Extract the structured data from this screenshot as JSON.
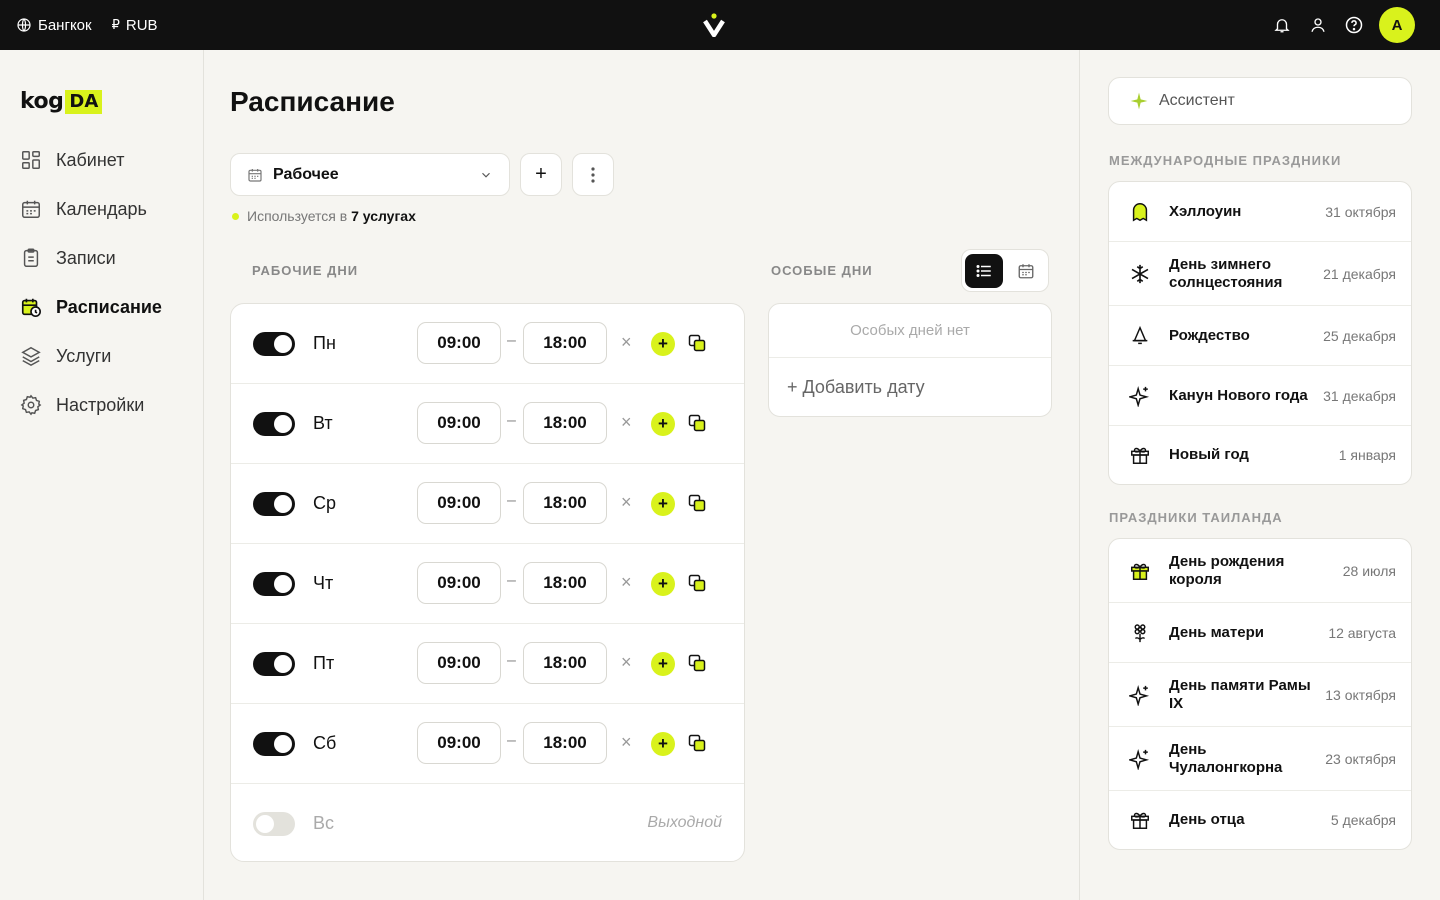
{
  "topbar": {
    "city": "Бангкок",
    "currency": "RUB",
    "avatar_letter": "A"
  },
  "logo": {
    "part1": "kog",
    "part2": "DA"
  },
  "sidebar": {
    "items": [
      {
        "label": "Кабинет",
        "icon": "dashboard-icon"
      },
      {
        "label": "Календарь",
        "icon": "calendar-icon"
      },
      {
        "label": "Записи",
        "icon": "clipboard-icon"
      },
      {
        "label": "Расписание",
        "icon": "schedule-icon",
        "active": true
      },
      {
        "label": "Услуги",
        "icon": "layers-icon"
      },
      {
        "label": "Настройки",
        "icon": "gear-icon"
      }
    ]
  },
  "main": {
    "title": "Расписание",
    "schedule_select": "Рабочее",
    "usage_prefix": "Используется в",
    "usage_count": "7 услугах",
    "working_days_label": "РАБОЧИЕ ДНИ",
    "special_days_label": "ОСОБЫЕ ДНИ",
    "special_empty": "Особых дней нет",
    "add_date": "+ Добавить дату",
    "day_off_label": "Выходной",
    "days": [
      {
        "name": "Пн",
        "enabled": true,
        "start": "09:00",
        "end": "18:00"
      },
      {
        "name": "Вт",
        "enabled": true,
        "start": "09:00",
        "end": "18:00"
      },
      {
        "name": "Ср",
        "enabled": true,
        "start": "09:00",
        "end": "18:00"
      },
      {
        "name": "Чт",
        "enabled": true,
        "start": "09:00",
        "end": "18:00"
      },
      {
        "name": "Пт",
        "enabled": true,
        "start": "09:00",
        "end": "18:00"
      },
      {
        "name": "Сб",
        "enabled": true,
        "start": "09:00",
        "end": "18:00"
      },
      {
        "name": "Вс",
        "enabled": false
      }
    ]
  },
  "right": {
    "assistant_label": "Ассистент",
    "intl_label": "МЕЖДУНАРОДНЫЕ ПРАЗДНИКИ",
    "intl_holidays": [
      {
        "name": "Хэллоуин",
        "date": "31 октября",
        "icon": "ghost-icon"
      },
      {
        "name": "День зимнего солнцестояния",
        "date": "21 декабря",
        "icon": "snowflake-icon"
      },
      {
        "name": "Рождество",
        "date": "25 декабря",
        "icon": "bell-icon"
      },
      {
        "name": "Канун Нового года",
        "date": "31 декабря",
        "icon": "sparkle-icon"
      },
      {
        "name": "Новый год",
        "date": "1 января",
        "icon": "gift-icon"
      }
    ],
    "thai_label": "ПРАЗДНИКИ ТАИЛАНДА",
    "thai_holidays": [
      {
        "name": "День рождения короля",
        "date": "28 июля",
        "icon": "gift-icon"
      },
      {
        "name": "День матери",
        "date": "12 августа",
        "icon": "flower-icon"
      },
      {
        "name": "День памяти Рамы IX",
        "date": "13 октября",
        "icon": "sparkle-icon"
      },
      {
        "name": "День Чулалонгкорна",
        "date": "23 октября",
        "icon": "sparkle-icon"
      },
      {
        "name": "День отца",
        "date": "5 декабря",
        "icon": "gift-icon"
      }
    ]
  },
  "colors": {
    "accent": "#d9f21c",
    "dark": "#111111",
    "background": "#f6f5f1"
  }
}
